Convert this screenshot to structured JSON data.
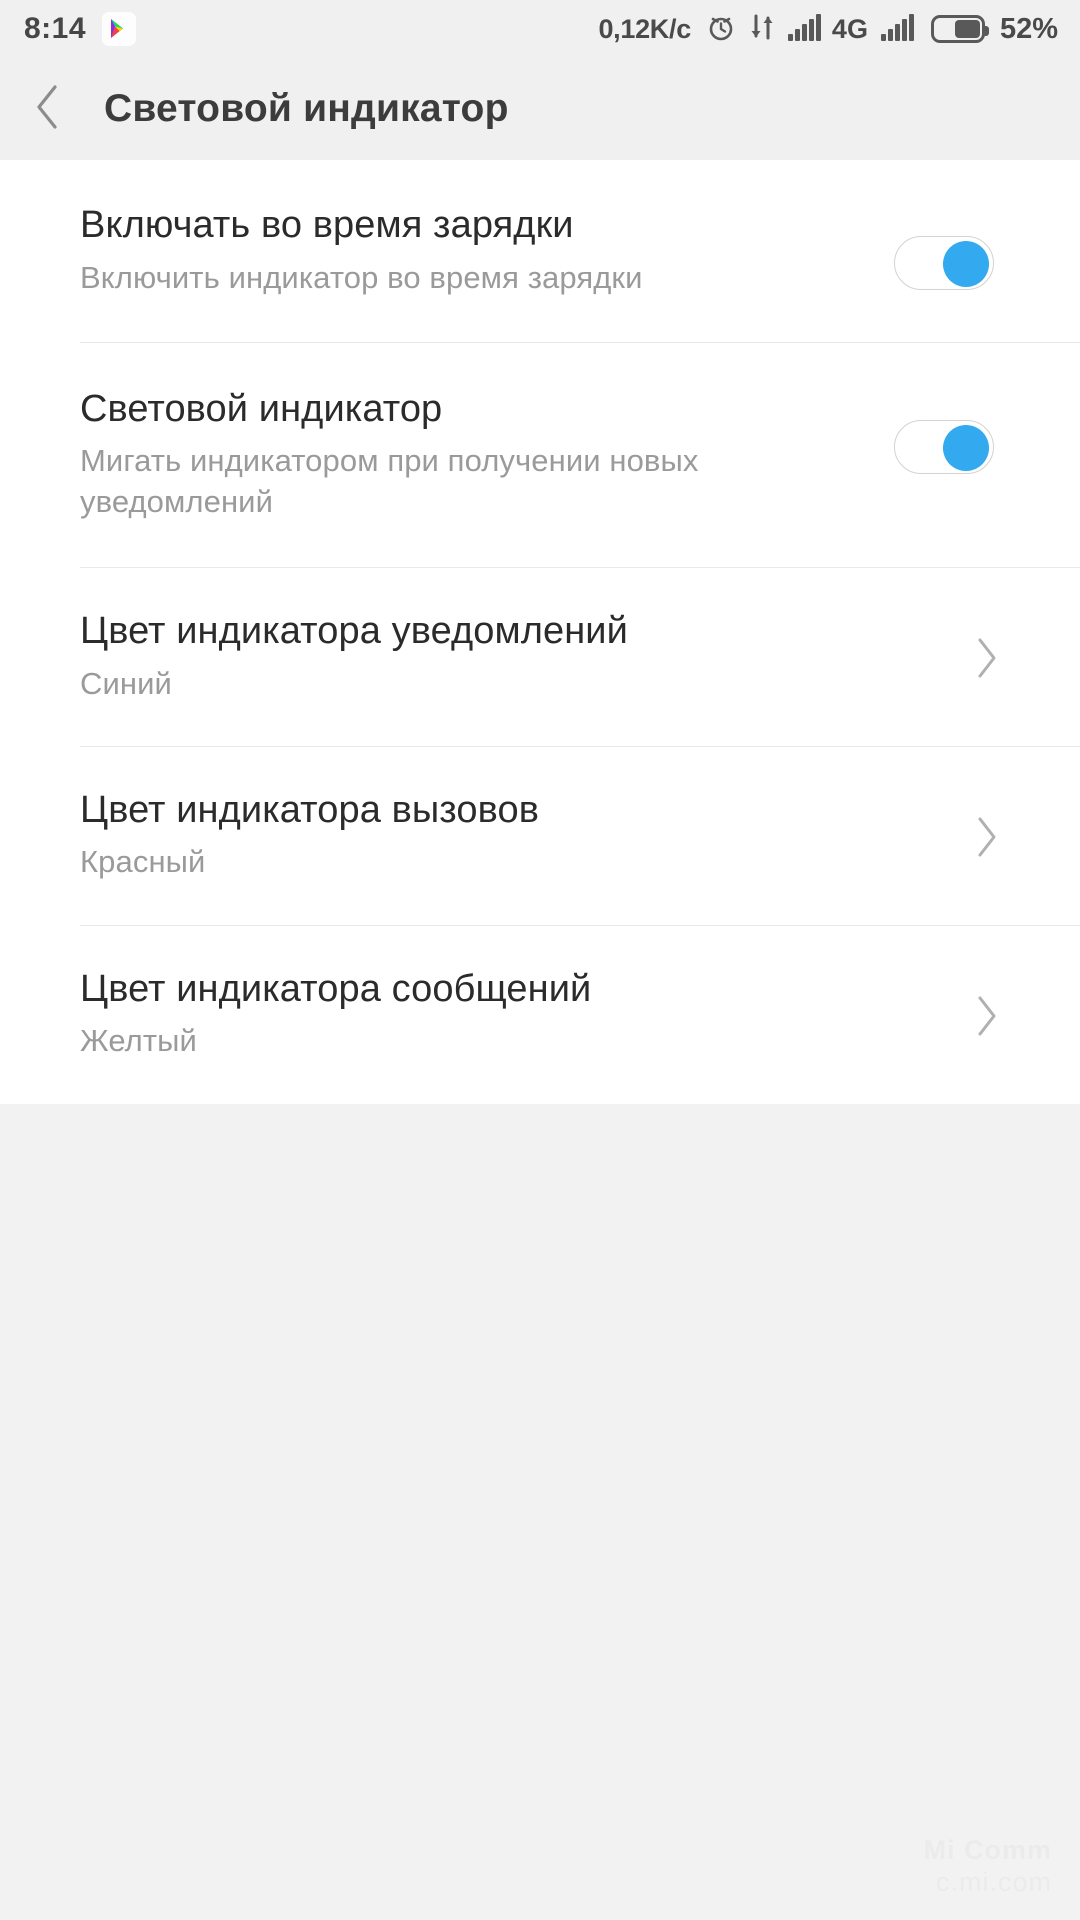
{
  "statusbar": {
    "clock": "8:14",
    "notification_icons": [
      "google-play-icon"
    ],
    "network_speed": "0,12K/c",
    "right_icons": [
      "alarm-icon",
      "data-transfer-icon",
      "signal-bars-icon",
      "signal-bars-icon-2"
    ],
    "network_type": "4G",
    "battery_percent": "52%",
    "battery_level": 52,
    "bar_bg": "#f0f0f0",
    "text_color": "#4a4a4a"
  },
  "appbar": {
    "back_icon": "chevron-left-icon",
    "title": "Световой индикатор",
    "bg": "#f0f0f0",
    "title_color": "#3c3c3c"
  },
  "theme": {
    "page_bg": "#f2f2f2",
    "card_bg": "#ffffff",
    "divider": "#e8e8e8",
    "title_color": "#2b2b2b",
    "subtitle_color": "#9a9a9a",
    "accent_blue": "#33a9ef",
    "switch_track": "#ffffff",
    "switch_border": "#d3d3d3"
  },
  "settings": {
    "rows": [
      {
        "title": "Включать во время зарядки",
        "subtitle": "Включить индикатор во время зарядки",
        "control": "toggle",
        "value": "on"
      },
      {
        "title": "Световой индикатор",
        "subtitle": "Мигать индикатором при получении новых уведомлений",
        "control": "toggle",
        "value": "on"
      },
      {
        "title": "Цвет индикатора уведомлений",
        "subtitle": "Синий",
        "control": "chevron",
        "value": "Синий"
      },
      {
        "title": "Цвет индикатора вызовов",
        "subtitle": "Красный",
        "control": "chevron",
        "value": "Красный"
      },
      {
        "title": "Цвет индикатора сообщений",
        "subtitle": "Желтый",
        "control": "chevron",
        "value": "Желтый"
      }
    ]
  },
  "watermark": {
    "line1": "Mi Comm",
    "line2": "c.mi.com",
    "color": "#ebebeb"
  }
}
